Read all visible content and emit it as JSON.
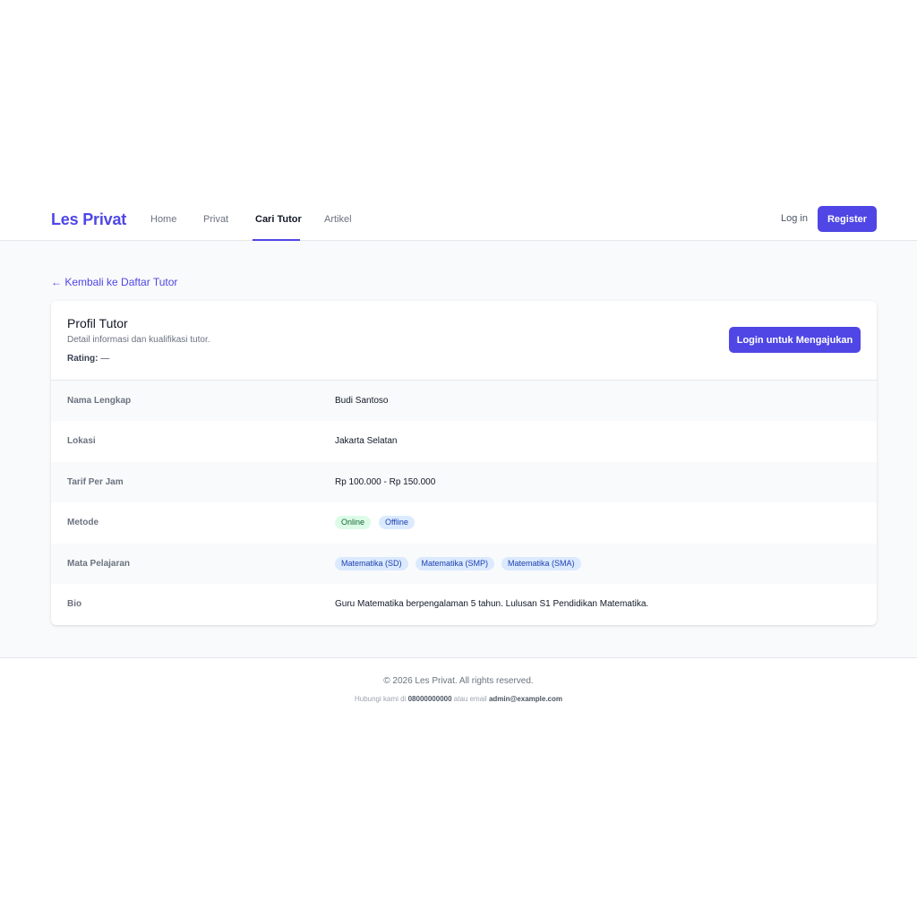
{
  "nav": {
    "brand": "Les Privat",
    "links": [
      {
        "label": "Home"
      },
      {
        "label": "Privat"
      },
      {
        "label": "Cari Tutor"
      },
      {
        "label": "Artikel"
      }
    ],
    "login_label": "Log in",
    "register_label": "Register"
  },
  "back_link": "← Kembali ke Daftar Tutor",
  "profile": {
    "title": "Profil Tutor",
    "subtitle": "Detail informasi dan kualifikasi tutor.",
    "rating_label": "Rating:",
    "rating_value": "—",
    "apply_label": "Login untuk Mengajukan",
    "rows": [
      {
        "label": "Nama Lengkap",
        "value": "Budi Santoso"
      },
      {
        "label": "Lokasi",
        "value": "Jakarta Selatan"
      },
      {
        "label": "Tarif Per Jam",
        "value": "Rp 100.000 - Rp 150.000"
      },
      {
        "label": "Metode",
        "badges": [
          "Online",
          "Offline"
        ]
      },
      {
        "label": "Mata Pelajaran",
        "badges": [
          "Matematika (SD)",
          "Matematika (SMP)",
          "Matematika (SMA)"
        ]
      },
      {
        "label": "Bio",
        "value": "Guru Matematika berpengalaman 5 tahun. Lulusan S1 Pendidikan Matematika."
      }
    ]
  },
  "footer": {
    "copyright": "© 2026 Les Privat. All rights reserved.",
    "contact_prefix": "Hubungi kami di",
    "phone": "08000000000",
    "contact_middle": "atau email",
    "email": "admin@example.com"
  },
  "colors": {
    "accent": "#4f46e5",
    "online_badge": "#dcfce7",
    "subject_badge": "#dbeafe"
  }
}
